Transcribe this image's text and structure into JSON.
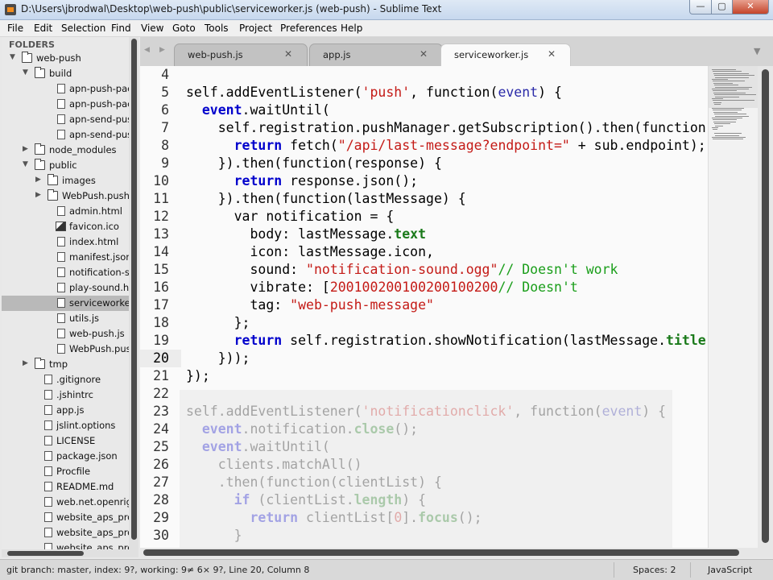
{
  "window": {
    "title": "D:\\Users\\jbrodwal\\Desktop\\web-push\\public\\serviceworker.js (web-push) - Sublime Text"
  },
  "window_controls": {
    "minimize": "—",
    "maximize": "▢",
    "close": "✕"
  },
  "menu": [
    "File",
    "Edit",
    "Selection",
    "Find",
    "View",
    "Goto",
    "Tools",
    "Project",
    "Preferences",
    "Help"
  ],
  "sidebar": {
    "header": "FOLDERS",
    "items": [
      {
        "label": "web-push",
        "type": "folder",
        "expanded": true
      },
      {
        "label": "build",
        "type": "folder",
        "expanded": true
      },
      {
        "label": "apn-push-pack-s",
        "type": "file"
      },
      {
        "label": "apn-push-pack.js",
        "type": "file"
      },
      {
        "label": "apn-send-push-t",
        "type": "file"
      },
      {
        "label": "apn-send-push.js",
        "type": "file"
      },
      {
        "label": "node_modules",
        "type": "folder",
        "expanded": false
      },
      {
        "label": "public",
        "type": "folder",
        "expanded": true
      },
      {
        "label": "images",
        "type": "folder",
        "expanded": false
      },
      {
        "label": "WebPush.pushp",
        "type": "folder",
        "expanded": false
      },
      {
        "label": "admin.html",
        "type": "file"
      },
      {
        "label": "favicon.ico",
        "type": "image"
      },
      {
        "label": "index.html",
        "type": "file"
      },
      {
        "label": "manifest.json",
        "type": "file"
      },
      {
        "label": "notification-soun",
        "type": "file"
      },
      {
        "label": "play-sound.html",
        "type": "file"
      },
      {
        "label": "serviceworker.js",
        "type": "file",
        "selected": true
      },
      {
        "label": "utils.js",
        "type": "file"
      },
      {
        "label": "web-push.js",
        "type": "file"
      },
      {
        "label": "WebPush.pushp",
        "type": "file"
      },
      {
        "label": "tmp",
        "type": "folder",
        "expanded": false
      },
      {
        "label": ".gitignore",
        "type": "file"
      },
      {
        "label": ".jshintrc",
        "type": "file"
      },
      {
        "label": "app.js",
        "type": "file"
      },
      {
        "label": "jslint.options",
        "type": "file"
      },
      {
        "label": "LICENSE",
        "type": "file"
      },
      {
        "label": "package.json",
        "type": "file"
      },
      {
        "label": "Procfile",
        "type": "file"
      },
      {
        "label": "README.md",
        "type": "file"
      },
      {
        "label": "web.net.openright",
        "type": "file"
      },
      {
        "label": "website_aps_produ",
        "type": "file"
      },
      {
        "label": "website_aps_produ",
        "type": "file"
      },
      {
        "label": "website_aps_produ",
        "type": "file"
      }
    ]
  },
  "tabs": [
    {
      "label": "web-push.js",
      "close": "✕",
      "active": false
    },
    {
      "label": "app.js",
      "close": "✕",
      "active": false
    },
    {
      "label": "serviceworker.js",
      "close": "✕",
      "active": true
    }
  ],
  "tab_nav": {
    "prev": "◀",
    "next": "▶",
    "overflow": "▼"
  },
  "editor": {
    "current_line": 20,
    "lines": [
      {
        "n": "4",
        "t": []
      },
      {
        "n": "5",
        "t": [
          [
            "",
            "self.addEventListener("
          ],
          [
            "str",
            "'push'"
          ],
          [
            "",
            ", function("
          ],
          [
            "arg",
            "event"
          ],
          [
            "",
            ") {"
          ]
        ]
      },
      {
        "n": "6",
        "t": [
          [
            "",
            "  "
          ],
          [
            "kwb",
            "event"
          ],
          [
            "",
            ".waitUntil("
          ]
        ]
      },
      {
        "n": "7",
        "t": [
          [
            "",
            "    self.registration.pushManager.getSubscription().then(function"
          ]
        ]
      },
      {
        "n": "8",
        "t": [
          [
            "",
            "      "
          ],
          [
            "kwb",
            "return"
          ],
          [
            "",
            " fetch("
          ],
          [
            "str",
            "\"/api/last-message?endpoint=\""
          ],
          [
            "",
            " + sub.endpoint);"
          ]
        ]
      },
      {
        "n": "9",
        "t": [
          [
            "",
            "    }).then(function(response) {"
          ]
        ]
      },
      {
        "n": "10",
        "t": [
          [
            "",
            "      "
          ],
          [
            "kwb",
            "return"
          ],
          [
            "",
            " response.json();"
          ]
        ]
      },
      {
        "n": "11",
        "t": [
          [
            "",
            "    }).then(function(lastMessage) {"
          ]
        ]
      },
      {
        "n": "12",
        "t": [
          [
            "",
            "      var notification = {"
          ]
        ]
      },
      {
        "n": "13",
        "t": [
          [
            "",
            "        body: lastMessage."
          ],
          [
            "prop",
            "text"
          ],
          [
            ","
          ]
        ]
      },
      {
        "n": "14",
        "t": [
          [
            "",
            "        icon: lastMessage.icon,"
          ]
        ]
      },
      {
        "n": "15",
        "t": [
          [
            "",
            "        sound: "
          ],
          [
            "str",
            "\"notification-sound.ogg\""
          ],
          [
            ",  "
          ],
          [
            "cmt",
            "// Doesn't work"
          ]
        ]
      },
      {
        "n": "16",
        "t": [
          [
            "",
            "        vibrate: ["
          ],
          [
            "num",
            "200"
          ],
          [
            ", "
          ],
          [
            "num",
            "100"
          ],
          [
            ", "
          ],
          [
            "num",
            "200"
          ],
          [
            ", "
          ],
          [
            "num",
            "100"
          ],
          [
            ", "
          ],
          [
            "num",
            "200"
          ],
          [
            ", "
          ],
          [
            "num",
            "100"
          ],
          [
            ", "
          ],
          [
            "num",
            "200"
          ],
          [
            "], "
          ],
          [
            "cmt",
            "// Doesn't"
          ]
        ]
      },
      {
        "n": "17",
        "t": [
          [
            "",
            "        tag: "
          ],
          [
            "str",
            "\"web-push-message\""
          ]
        ]
      },
      {
        "n": "18",
        "t": [
          [
            "",
            "      };"
          ]
        ]
      },
      {
        "n": "19",
        "t": [
          [
            "",
            "      "
          ],
          [
            "kwb",
            "return"
          ],
          [
            "",
            " self.registration.showNotification(lastMessage."
          ],
          [
            "prop",
            "title"
          ]
        ]
      },
      {
        "n": "20",
        "t": [
          [
            "",
            "    }));"
          ]
        ]
      },
      {
        "n": "21",
        "t": [
          [
            "",
            "});"
          ]
        ]
      },
      {
        "n": "22",
        "t": []
      },
      {
        "n": "23",
        "t": [
          [
            "fd",
            "self.addEventListener("
          ],
          [
            "fd str",
            "'notificationclick'"
          ],
          [
            "fd",
            ", function("
          ],
          [
            "fd arg",
            "event"
          ],
          [
            "fd",
            ") {"
          ]
        ]
      },
      {
        "n": "24",
        "t": [
          [
            "",
            "  "
          ],
          [
            "fd kwb",
            "event"
          ],
          [
            "fd",
            ".notification."
          ],
          [
            "fd prop",
            "close"
          ],
          [
            "fd",
            "();"
          ]
        ]
      },
      {
        "n": "25",
        "t": [
          [
            "",
            "  "
          ],
          [
            "fd kwb",
            "event"
          ],
          [
            "fd",
            ".waitUntil("
          ]
        ]
      },
      {
        "n": "26",
        "t": [
          [
            "",
            "    "
          ],
          [
            "fd",
            "clients.matchAll()"
          ]
        ]
      },
      {
        "n": "27",
        "t": [
          [
            "",
            "    "
          ],
          [
            "fd",
            ".then(function(clientList) {"
          ]
        ]
      },
      {
        "n": "28",
        "t": [
          [
            "",
            "      "
          ],
          [
            "fd kwb",
            "if"
          ],
          [
            "fd",
            " (clientList."
          ],
          [
            "fd prop",
            "length"
          ],
          [
            "fd",
            ") {"
          ]
        ]
      },
      {
        "n": "29",
        "t": [
          [
            "",
            "        "
          ],
          [
            "fd kwb",
            "return"
          ],
          [
            "fd",
            " clientList["
          ],
          [
            "fd num",
            "0"
          ],
          [
            "fd",
            "]."
          ],
          [
            "fd prop",
            "focus"
          ],
          [
            "fd",
            "();"
          ]
        ]
      },
      {
        "n": "30",
        "t": [
          [
            "",
            "      "
          ],
          [
            "fd",
            "}"
          ]
        ]
      }
    ]
  },
  "status": {
    "left": "git branch: master, index: 9?, working: 9≠ 6× 9?, Line 20, Column 8",
    "spaces": "Spaces: 2",
    "syntax": "JavaScript"
  },
  "colors": {
    "keyword": "#0000cc",
    "string": "#c41a16",
    "comment": "#1a9e1a",
    "property": "#1a7a1a",
    "selection": "#b9b9b9"
  }
}
